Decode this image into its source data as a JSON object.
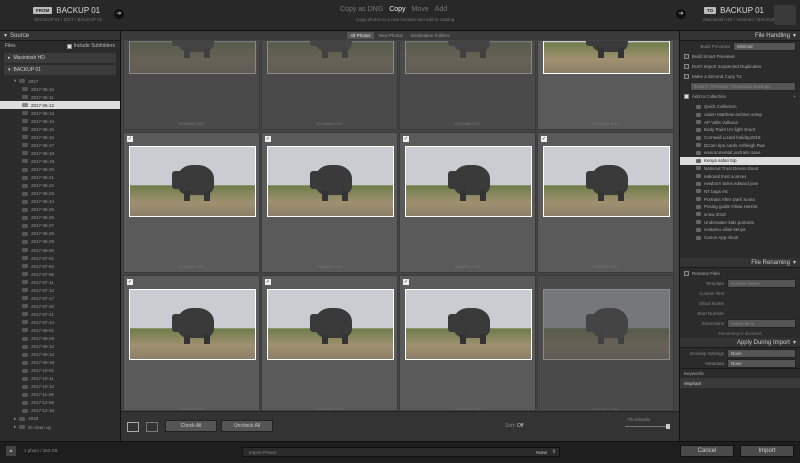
{
  "topbar": {
    "from_badge": "FROM",
    "source_name": "BACKUP 01",
    "source_path": "/BACKUP 01 / 2017 / BACKUP 01",
    "modes": [
      "Copy as DNG",
      "Copy",
      "Move",
      "Add"
    ],
    "active_mode": "Copy",
    "mode_description": "Copy photos to a new location and add to catalog",
    "to_badge": "TO",
    "dest_name": "BACKUP 01",
    "dest_path": "/Macintosh HD / Volumes / BACKUP 01"
  },
  "source": {
    "title": "Source",
    "files_label": "Files",
    "include_subfolders": "Include Subfolders",
    "volumes": [
      "Macintosh HD",
      "BACKUP 01"
    ],
    "tree_top": "2017",
    "folders": [
      "2017-05-16",
      "2017-06-11",
      "2017-06-12",
      "2017-06-13",
      "2017-06-14",
      "2017-06-15",
      "2017-06-16",
      "2017-06-17",
      "2017-06-18",
      "2017-06-19",
      "2017-06-20",
      "2017-06-21",
      "2017-06-22",
      "2017-06-23",
      "2017-06-24",
      "2017-06-25",
      "2017-06-26",
      "2017-06-27",
      "2017-06-28",
      "2017-06-29",
      "2017-06-30",
      "2017-07-01",
      "2017-07-04",
      "2017-07-06",
      "2017-07-11",
      "2017-07-12",
      "2017-07-17",
      "2017-07-20",
      "2017-07-21",
      "2017-07-24",
      "2017-08-01",
      "2017-08-29",
      "2017-09-12",
      "2017-09-13",
      "2017-09-19",
      "2017-10-01",
      "2017-10-11",
      "2017-10-12",
      "2017-11-29",
      "2017-12-08",
      "2017-12-18"
    ],
    "selected_folder": "2017-06-12",
    "bottom_items": [
      "2018",
      "its clean up"
    ]
  },
  "center": {
    "tabs": [
      "All Photos",
      "New Photos",
      "Destination Folders"
    ],
    "active_tab": "All Photos",
    "photos": [
      {
        "file": "SSA9863.CR2",
        "checked": false
      },
      {
        "file": "SSA9864.CR2",
        "checked": false
      },
      {
        "file": "SSA9865.CR2",
        "checked": false
      },
      {
        "file": "SSA9866.CR2",
        "checked": true
      },
      {
        "file": "SSA9870.CR2",
        "checked": true
      },
      {
        "file": "SSA9871.CR2",
        "checked": true
      },
      {
        "file": "SSA9872.CR2",
        "checked": true
      },
      {
        "file": "SSA9873.CR2",
        "checked": true
      },
      {
        "file": "SSA9874.CR2",
        "checked": true
      },
      {
        "file": "SSA9875.CR2",
        "checked": true
      },
      {
        "file": "SSA9876.CR2",
        "checked": true
      },
      {
        "file": "SSA9877.CR2",
        "checked": false
      }
    ],
    "check_all": "Check All",
    "uncheck_all": "Uncheck All",
    "sort_label": "Sort:",
    "sort_value": "Off",
    "thumbnails_label": "Thumbnails"
  },
  "right": {
    "file_handling": "File Handling",
    "build_previews_label": "Build Previews",
    "build_previews_value": "Minimal",
    "build_smart_previews": "Build Smart Previews",
    "dont_import_duplicates": "Don't Import Suspected Duplicates",
    "second_copy": "Make a Second Copy To:",
    "second_copy_path": "/Users / /Pictures / Download Backups",
    "add_to_collection": "Add to Collection",
    "collections": [
      "Quick Collection",
      "Adam Matthew archive setup",
      "AP Valts Volkova",
      "Body Paint UV light shoot",
      "Cornwall Lizard holiday2018",
      "DCam tips cards Ashleigh Rae",
      "environmental portraits save",
      "Kenya safari trip",
      "National Trust Devon shoot",
      "national trust scarves",
      "newborn twins edward jose",
      "NT bags etc",
      "Portraits After Dark Sonia",
      "Posing guide Olivia Harriet",
      "snow 2018",
      "Underwater kids portraits",
      "vostamu villas kenya",
      "Canon App shoot"
    ],
    "selected_collection": "Kenya safari trip",
    "file_renaming": "File Renaming",
    "rename_files": "Rename Files",
    "template_label": "Template",
    "template_value": "Custom Name",
    "custom_text": "Custom Text",
    "shoot_name": "Shoot Name",
    "start_number": "Start Number",
    "extensions_label": "Extensions",
    "extensions_value": "Leave as-is",
    "renaming_disabled": "Renaming is disabled",
    "apply_during_import": "Apply During Import",
    "develop_settings_label": "Develop Settings",
    "develop_settings_value": "None",
    "metadata_label": "Metadata",
    "metadata_value": "None",
    "keywords_label": "Keywords",
    "keywords_value": "elephant"
  },
  "footer": {
    "status": "1 photo / 363 KB",
    "import_preset_label": "Import Preset :",
    "import_preset_value": "None",
    "cancel": "Cancel",
    "import": "Import"
  }
}
